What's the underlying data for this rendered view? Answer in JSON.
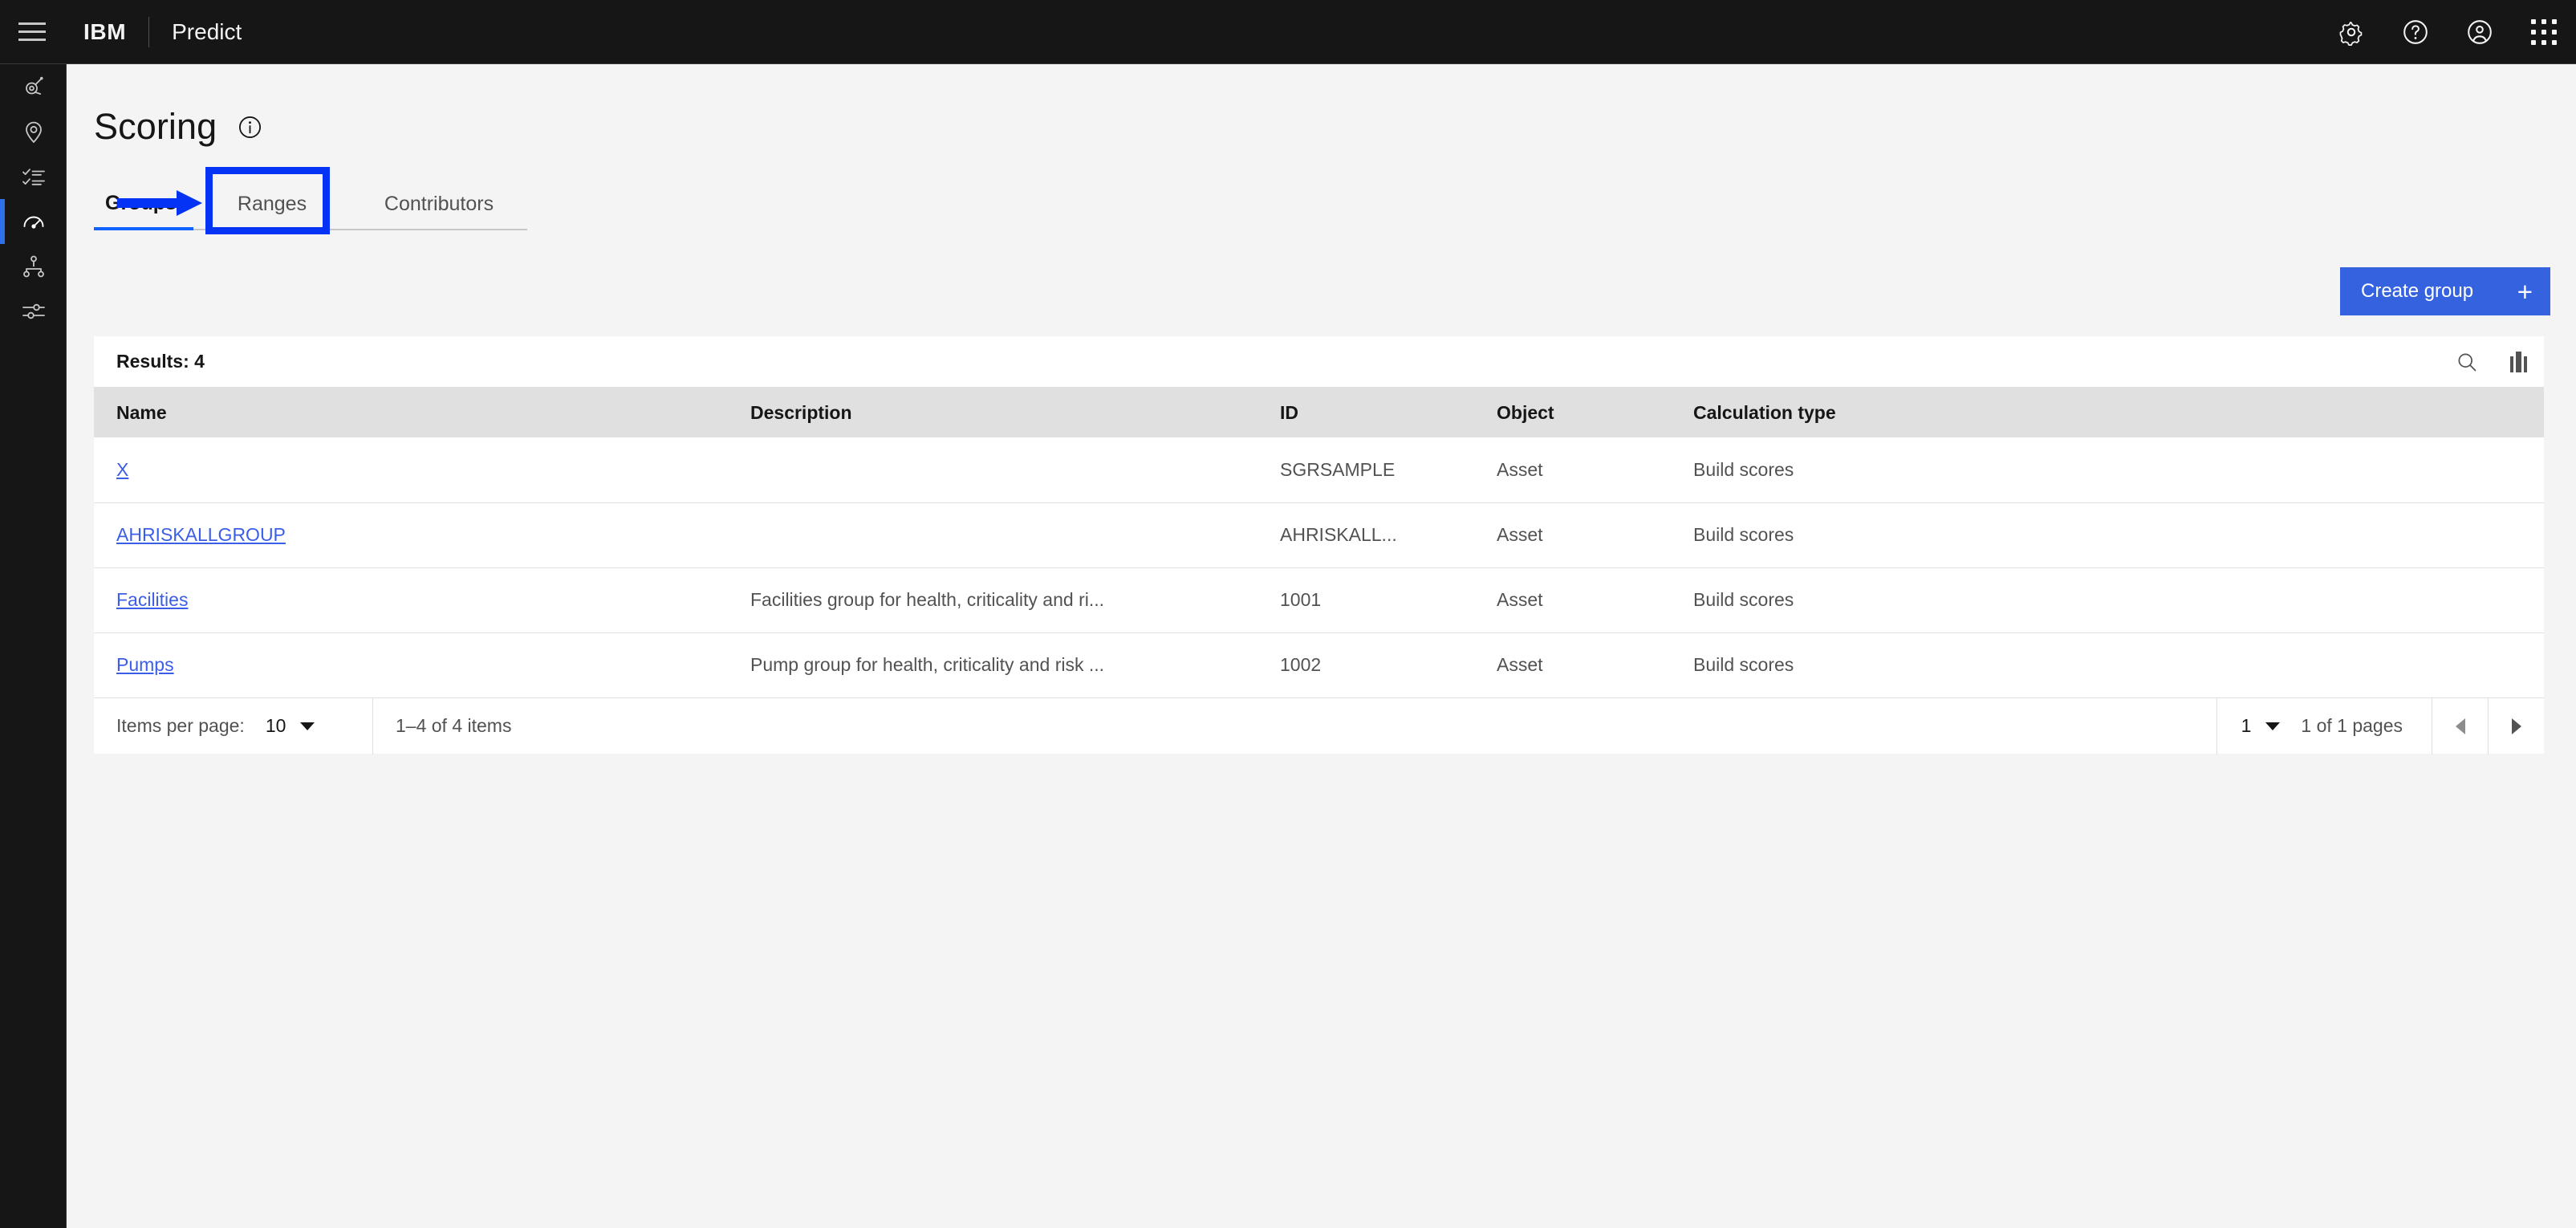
{
  "header": {
    "menu_icon": "hamburger-menu-icon",
    "brand": "IBM",
    "product": "Predict",
    "icons": [
      {
        "name": "settings-gear-icon",
        "label": "Settings"
      },
      {
        "name": "help-question-icon",
        "label": "Help"
      },
      {
        "name": "user-avatar-icon",
        "label": "Account"
      },
      {
        "name": "app-switcher-grid-icon",
        "label": "App switcher"
      }
    ]
  },
  "sidebar": {
    "items": [
      {
        "name": "asset-icon",
        "label": "Assets",
        "active": false
      },
      {
        "name": "location-pin-icon",
        "label": "Locations",
        "active": false
      },
      {
        "name": "task-list-icon",
        "label": "Work",
        "active": false
      },
      {
        "name": "gauge-meter-icon",
        "label": "Scoring",
        "active": true
      },
      {
        "name": "hierarchy-tree-icon",
        "label": "Hierarchy",
        "active": false
      },
      {
        "name": "sliders-settings-icon",
        "label": "Settings",
        "active": false
      }
    ]
  },
  "page": {
    "title": "Scoring",
    "info_icon": "information-circle-icon"
  },
  "tabs": [
    {
      "label": "Groups",
      "selected": true
    },
    {
      "label": "Ranges",
      "selected": false,
      "highlighted": true
    },
    {
      "label": "Contributors",
      "selected": false
    }
  ],
  "annotation": {
    "arrow_color": "#0433f5",
    "box_color": "#0433f5",
    "points_to": "Ranges"
  },
  "toolbar": {
    "create_label": "Create group",
    "create_plus": "+",
    "create_bg": "#3563e0"
  },
  "table": {
    "results_label": "Results: 4",
    "search_icon": "search-icon",
    "columns_icon": "column-settings-icon",
    "columns": [
      "Name",
      "Description",
      "ID",
      "Object",
      "Calculation type"
    ],
    "rows": [
      {
        "name": "X",
        "description": "",
        "id": "SGRSAMPLE",
        "object": "Asset",
        "calculation_type": "Build scores"
      },
      {
        "name": "AHRISKALLGROUP",
        "description": "",
        "id": "AHRISKALL...",
        "object": "Asset",
        "calculation_type": "Build scores"
      },
      {
        "name": "Facilities",
        "description": "Facilities group for health, criticality and ri...",
        "id": "1001",
        "object": "Asset",
        "calculation_type": "Build scores"
      },
      {
        "name": "Pumps",
        "description": "Pump group for health, criticality and risk ...",
        "id": "1002",
        "object": "Asset",
        "calculation_type": "Build scores"
      }
    ]
  },
  "pagination": {
    "items_per_page_label": "Items per page:",
    "items_per_page_value": "10",
    "range_text": "1–4 of 4 items",
    "page_value": "1",
    "pages_text": "1 of 1 pages",
    "prev_icon": "caret-left-icon",
    "next_icon": "caret-right-icon"
  },
  "colors": {
    "header_bg": "#161616",
    "page_bg": "#f4f4f4",
    "accent_blue": "#0f62fe",
    "link_blue": "#3b5ee8",
    "annotation_blue": "#0433f5"
  }
}
